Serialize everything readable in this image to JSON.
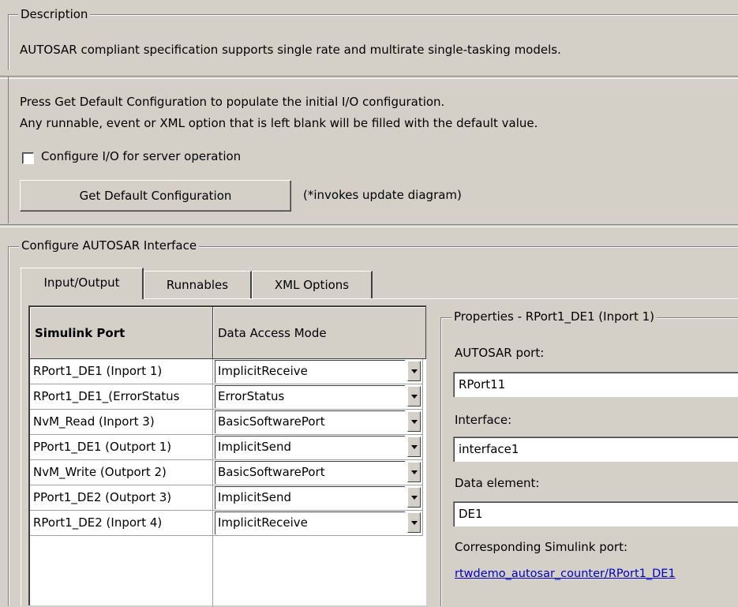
{
  "description": {
    "legend": "Description",
    "text": "AUTOSAR compliant specification supports single rate and multirate single-tasking models."
  },
  "config": {
    "line1": "Press Get Default Configuration to populate the initial I/O configuration.",
    "line2": "Any runnable, event or XML option that is left blank will be filled with the default value.",
    "server_checkbox_label": "Configure I/O for server operation",
    "server_checkbox_checked": false,
    "get_default_button": "Get Default Configuration",
    "button_note": "(*invokes update diagram)"
  },
  "interface": {
    "legend": "Configure AUTOSAR Interface",
    "tabs": [
      {
        "label": "Input/Output",
        "active": true
      },
      {
        "label": "Runnables",
        "active": false
      },
      {
        "label": "XML Options",
        "active": false
      }
    ],
    "table": {
      "columns": [
        "Simulink Port",
        "Data Access Mode"
      ],
      "rows": [
        {
          "port": "RPort1_DE1 (Inport 1)",
          "mode": "ImplicitReceive"
        },
        {
          "port": "RPort1_DE1_(ErrorStatus",
          "mode": "ErrorStatus"
        },
        {
          "port": "NvM_Read (Inport 3)",
          "mode": "BasicSoftwarePort"
        },
        {
          "port": "PPort1_DE1 (Outport 1)",
          "mode": "ImplicitSend"
        },
        {
          "port": "NvM_Write (Outport 2)",
          "mode": "BasicSoftwarePort"
        },
        {
          "port": "PPort1_DE2 (Outport 3)",
          "mode": "ImplicitSend"
        },
        {
          "port": "RPort1_DE2 (Inport 4)",
          "mode": "ImplicitReceive"
        }
      ]
    },
    "properties": {
      "legend": "Properties - RPort1_DE1 (Inport 1)",
      "autosar_port_label": "AUTOSAR port:",
      "autosar_port_value": "RPort11",
      "interface_label": "Interface:",
      "interface_value": "interface1",
      "data_element_label": "Data element:",
      "data_element_value": "DE1",
      "simulink_port_label": "Corresponding Simulink port:",
      "simulink_port_link": "rtwdemo_autosar_counter/RPort1_DE1"
    }
  }
}
